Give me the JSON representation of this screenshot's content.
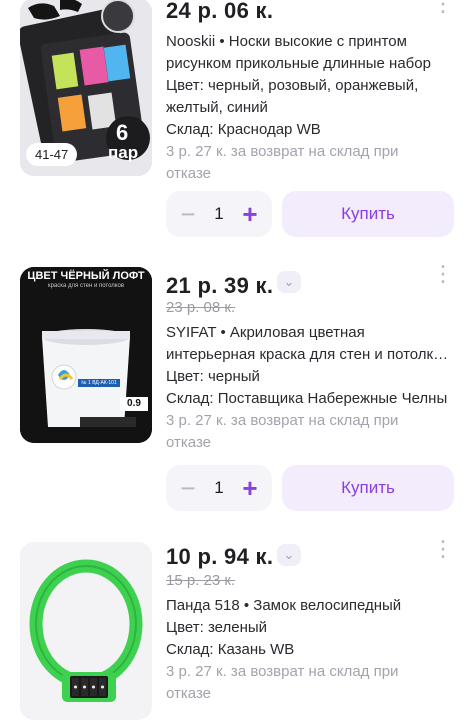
{
  "colors": {
    "accent": "#8a3fe0",
    "accent_bg": "#f3ecfd",
    "muted_text": "#a3a3ad",
    "lock_green": "#3ed04f"
  },
  "products": [
    {
      "price": "24 р. 06 к.",
      "old_price": "",
      "title": "Nooskii • Носки высокие с принтом рисунком прикольные длинные набор",
      "title_lines": [
        "Nooskii • Носки высокие с принтом",
        "рисунком прикольные длинные набор"
      ],
      "color_lines": [
        "Цвет: черный, розовый, оранжевый,",
        "желтый, синий"
      ],
      "warehouse": "Склад: Краснодар WB",
      "return_lines": [
        "3 р. 27 к. за возврат на склад при",
        "отказе"
      ],
      "size_badge": "41-47",
      "image_text": {
        "count": "6",
        "unit": "пар"
      },
      "quantity": "1",
      "buy_label": "Купить",
      "minus_glyph": "−",
      "plus_glyph": "+",
      "more_icon": "more-vertical-icon"
    },
    {
      "price": "21 р. 39 к.",
      "old_price": "23 р. 08 к.",
      "title": "SYIFAT • Акриловая цветная интерьерная краска для стен и потолк…",
      "title_lines": [
        "SYIFAT • Акриловая цветная",
        "интерьерная краска для стен и потолк…"
      ],
      "color_lines": [
        "Цвет: черный"
      ],
      "warehouse": "Склад: Поставщика Набережные Челны",
      "return_lines": [
        "3 р. 27 к. за возврат на склад при",
        "отказе"
      ],
      "image_text": {
        "header": "ЦВЕТ ЧЁРНЫЙ ЛОФТ",
        "subheader": "краска для стен и потолков",
        "code": "№ 1 ВД-АК-101",
        "weight": "0.9"
      },
      "quantity": "1",
      "buy_label": "Купить",
      "minus_glyph": "−",
      "plus_glyph": "+",
      "more_icon": "more-vertical-icon"
    },
    {
      "price": "10 р. 94 к.",
      "old_price": "15 р. 23 к.",
      "title": "Панда 518 • Замок велосипедный",
      "title_lines": [
        "Панда 518 • Замок велосипедный"
      ],
      "color_lines": [
        "Цвет: зеленый"
      ],
      "warehouse": "Склад: Казань WB",
      "return_lines": [
        "3 р. 27 к. за возврат на склад при",
        "отказе"
      ],
      "more_icon": "more-vertical-icon"
    }
  ],
  "chevron_glyph": "⌄",
  "more_glyph": "⋮"
}
